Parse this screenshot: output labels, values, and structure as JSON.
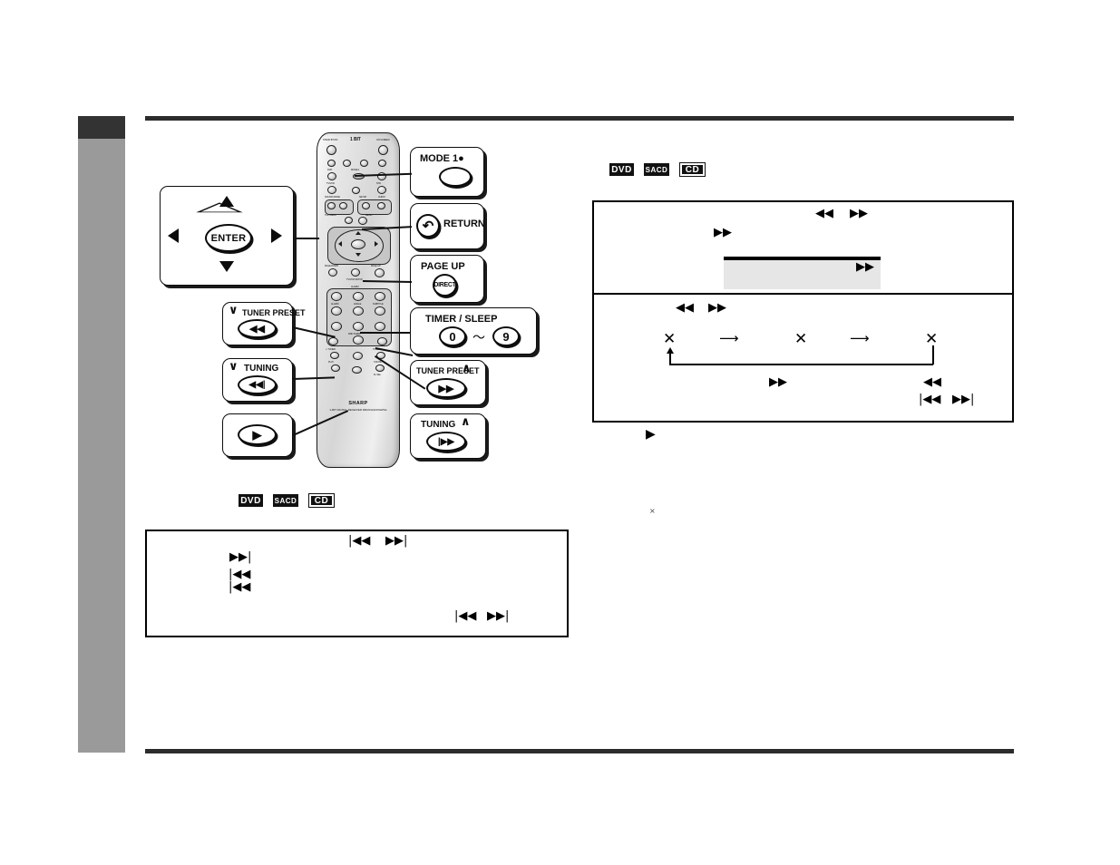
{
  "page": {
    "product_brand": "SHARP",
    "product_model": "1-BIT DIGITAL RECEIVER RRMCG0125AWSA"
  },
  "media_badges": [
    {
      "id": "dvd",
      "label": "DVD"
    },
    {
      "id": "sacd",
      "label": "SACD"
    },
    {
      "id": "cd",
      "label": "CD"
    }
  ],
  "remote_callouts": {
    "dpad": {
      "enter_label": "ENTER",
      "up_glyph": "▲",
      "down_glyph": "▼",
      "left_glyph": "◀",
      "right_glyph": "▶"
    },
    "items": [
      {
        "name": "mode-1",
        "label": "MODE 1●",
        "button_glyph": ""
      },
      {
        "name": "return",
        "label": "RETURN",
        "button_glyph": "↶"
      },
      {
        "name": "page-up",
        "label": "PAGE UP",
        "button_glyph": "DIRECT"
      },
      {
        "name": "timer-sleep",
        "label": "TIMER / SLEEP",
        "button_glyph": "0",
        "range_glyph": "～",
        "button_glyph_2": "9"
      },
      {
        "name": "tuner-preset-down",
        "label": "TUNER PRESET",
        "chevron": "∨",
        "button_glyph": "◀◀"
      },
      {
        "name": "tuning-down",
        "label": "TUNING",
        "chevron": "∨",
        "button_glyph": "◀◀|"
      },
      {
        "name": "play",
        "label": "",
        "button_glyph": "▶"
      },
      {
        "name": "tuner-preset-up",
        "label": "TUNER PRESET",
        "chevron": "∧",
        "button_glyph": "▶▶"
      },
      {
        "name": "tuning-up",
        "label": "TUNING",
        "chevron": "∧",
        "button_glyph": "|▶▶"
      }
    ]
  },
  "remote_body_labels": {
    "top_left": "STAND BY/ON",
    "top_center": "1 BIT",
    "top_right": "ON SCREEN",
    "row_dvd": "DVD",
    "row_tvvcr": "TV/VCR",
    "row_mode1": "MODE 1",
    "row_std": "STD",
    "sound_mode": "SOUND MODE",
    "setup": "SETUP",
    "audio": "AUDIO",
    "top_menu": "TOP MENU",
    "menu": "MENU",
    "page_down": "PAGE DOWN",
    "page_up": "PAGE UP",
    "tv_vcr_setup": "TV/VCR SETUP",
    "alarm": "ALARM",
    "angle": "ANGLE",
    "subtitle": "SUBTITLE",
    "rnd_sleep": "RND SLEEP",
    "tuner_preset_down": "∨ TUNER",
    "tuner_preset_up": "TUNER ∧",
    "play": "PLAY",
    "x_rate": "X-RATE",
    "fl_sel": "FL SEL"
  },
  "left_panel": {
    "box": {
      "glyphs": [
        {
          "name": "skip-prev-glyph-1",
          "char": "|◀◀"
        },
        {
          "name": "skip-next-glyph-1",
          "char": "▶▶|"
        },
        {
          "name": "skip-next-glyph-2",
          "char": "▶▶|"
        },
        {
          "name": "skip-prev-glyph-2",
          "char": "|◀◀"
        },
        {
          "name": "skip-prev-glyph-3",
          "char": "|◀◀"
        },
        {
          "name": "skip-prev-glyph-4",
          "char": "|◀◀"
        },
        {
          "name": "skip-next-glyph-3",
          "char": "▶▶|"
        }
      ]
    }
  },
  "right_panel": {
    "upper_box": {
      "glyphs": [
        {
          "name": "rewind-glyph-1",
          "char": "◀◀"
        },
        {
          "name": "forward-glyph-1",
          "char": "▶▶"
        },
        {
          "name": "forward-glyph-2",
          "char": "▶▶"
        }
      ],
      "highlight": {
        "name": "highlight-field",
        "glyph": "▶▶"
      }
    },
    "lower_box": {
      "glyphs": [
        {
          "name": "rewind-glyph-2",
          "char": "◀◀"
        },
        {
          "name": "forward-glyph-3",
          "char": "▶▶"
        },
        {
          "name": "forward-glyph-4",
          "char": "▶▶"
        },
        {
          "name": "rewind-glyph-3",
          "char": "◀◀"
        },
        {
          "name": "skip-prev-glyph-5",
          "char": "|◀◀"
        },
        {
          "name": "skip-next-glyph-4",
          "char": "▶▶|"
        }
      ],
      "flow": {
        "nodes": [
          {
            "name": "flow-node-1",
            "char": "✕"
          },
          {
            "name": "flow-node-2",
            "char": "✕"
          },
          {
            "name": "flow-node-3",
            "char": "✕"
          }
        ],
        "arrows": [
          {
            "name": "flow-arrow-1",
            "char": "⟶"
          },
          {
            "name": "flow-arrow-2",
            "char": "⟶"
          }
        ]
      }
    },
    "below": {
      "play_glyph": {
        "name": "play-glyph",
        "char": "▶"
      },
      "times_glyph": {
        "name": "times-glyph",
        "char": "×"
      }
    }
  }
}
